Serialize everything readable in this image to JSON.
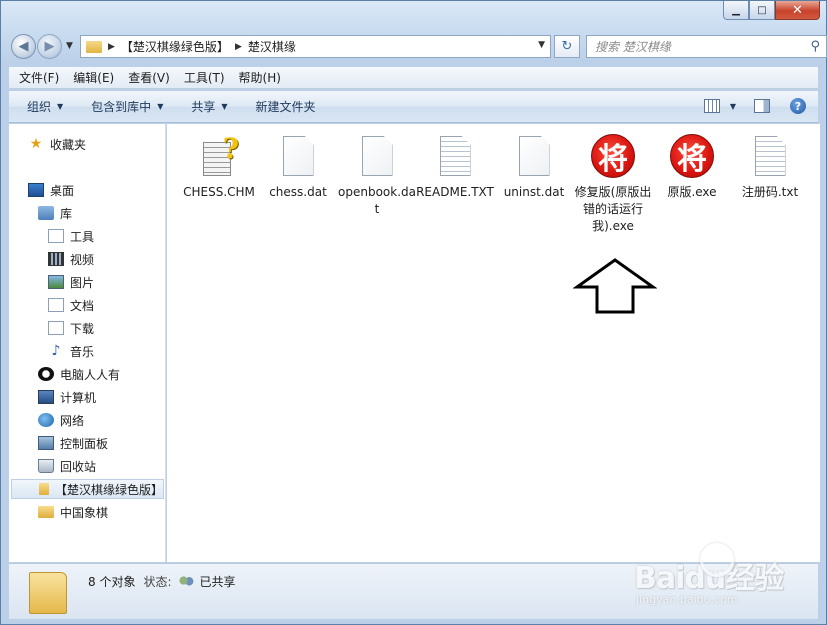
{
  "window": {
    "caption": {
      "minimize": "▁",
      "maximize": "□",
      "close": "✕"
    }
  },
  "address": {
    "crumbs": [
      "【楚汉棋缘绿色版】",
      "楚汉棋缘"
    ],
    "search_placeholder": "搜索 楚汉棋缘"
  },
  "menu": [
    "文件(F)",
    "编辑(E)",
    "查看(V)",
    "工具(T)",
    "帮助(H)"
  ],
  "commands": {
    "organize": "组织",
    "include_library": "包含到库中",
    "share": "共享",
    "new_folder": "新建文件夹"
  },
  "nav": {
    "favorites": "收藏夹",
    "desktop": "桌面",
    "libraries": "库",
    "lib_items": [
      "工具",
      "视频",
      "图片",
      "文档",
      "下载",
      "音乐"
    ],
    "others": [
      "电脑人人有",
      "计算机",
      "网络",
      "控制面板",
      "回收站"
    ],
    "selected_folder": "【楚汉棋缘绿色版】",
    "other_folder": "中国象棋"
  },
  "files": [
    {
      "name": "CHESS.CHM",
      "icon": "chm-help-icon"
    },
    {
      "name": "chess.dat",
      "icon": "blank-file-icon"
    },
    {
      "name": "openbook.dat",
      "icon": "blank-file-icon"
    },
    {
      "name": "README.TXT",
      "icon": "text-file-icon"
    },
    {
      "name": "uninst.dat",
      "icon": "blank-file-icon"
    },
    {
      "name": "修复版(原版出错的话运行我).exe",
      "icon": "chess-piece-icon"
    },
    {
      "name": "原版.exe",
      "icon": "chess-piece-icon"
    },
    {
      "name": "注册码.txt",
      "icon": "text-file-icon"
    }
  ],
  "chess_glyph": "将",
  "status": {
    "count": "8 个对象",
    "state_label": "状态:",
    "state_value": "已共享"
  },
  "watermark": {
    "brand": "Baidu经验",
    "url": "jingyan.baidu.com"
  }
}
